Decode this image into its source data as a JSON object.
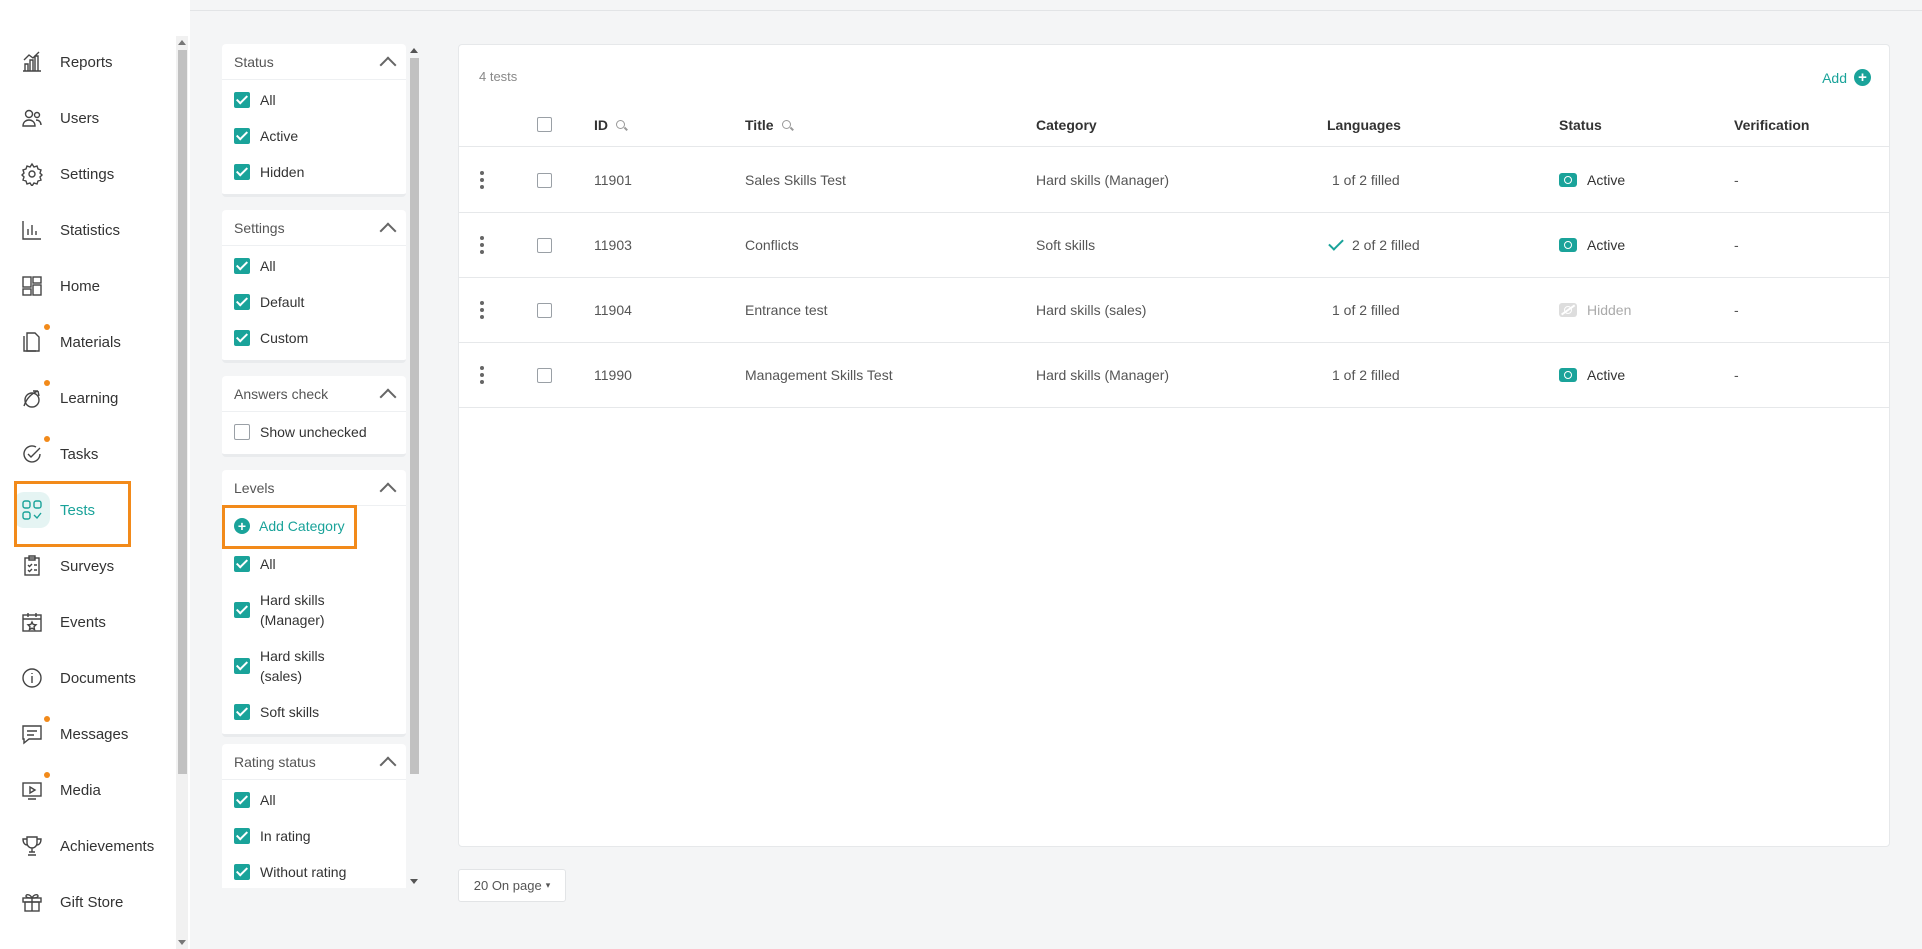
{
  "nav": {
    "items": [
      {
        "label": "Reports",
        "icon": "reports-icon",
        "dot": false
      },
      {
        "label": "Users",
        "icon": "users-icon",
        "dot": false
      },
      {
        "label": "Settings",
        "icon": "gear-icon",
        "dot": false
      },
      {
        "label": "Statistics",
        "icon": "statistics-icon",
        "dot": false
      },
      {
        "label": "Home",
        "icon": "home-icon",
        "dot": false
      },
      {
        "label": "Materials",
        "icon": "materials-icon",
        "dot": true
      },
      {
        "label": "Learning",
        "icon": "learning-icon",
        "dot": true
      },
      {
        "label": "Tasks",
        "icon": "tasks-icon",
        "dot": true
      },
      {
        "label": "Tests",
        "icon": "tests-icon",
        "dot": false,
        "active": true
      },
      {
        "label": "Surveys",
        "icon": "surveys-icon",
        "dot": false
      },
      {
        "label": "Events",
        "icon": "calendar-icon",
        "dot": false
      },
      {
        "label": "Documents",
        "icon": "info-icon",
        "dot": false
      },
      {
        "label": "Messages",
        "icon": "chat-icon",
        "dot": true
      },
      {
        "label": "Media",
        "icon": "media-icon",
        "dot": true
      },
      {
        "label": "Achievements",
        "icon": "trophy-icon",
        "dot": false
      },
      {
        "label": "Gift Store",
        "icon": "gift-icon",
        "dot": false
      }
    ]
  },
  "filters": {
    "status": {
      "title": "Status",
      "options": [
        "All",
        "Active",
        "Hidden"
      ]
    },
    "settings": {
      "title": "Settings",
      "options": [
        "All",
        "Default",
        "Custom"
      ]
    },
    "answers_check": {
      "title": "Answers check",
      "options": [
        "Show unchecked"
      ]
    },
    "levels": {
      "title": "Levels",
      "add_label": "Add Category",
      "options": [
        "All",
        "Hard skills (Manager)",
        "Hard skills (sales)",
        "Soft skills"
      ]
    },
    "rating_status": {
      "title": "Rating status",
      "options": [
        "All",
        "In rating",
        "Without rating"
      ]
    }
  },
  "table": {
    "count_label": "4 tests",
    "add_label": "Add",
    "columns": {
      "id": "ID",
      "title": "Title",
      "category": "Category",
      "languages": "Languages",
      "status": "Status",
      "verification": "Verification"
    },
    "rows": [
      {
        "id": "11901",
        "title": "Sales Skills Test",
        "category": "Hard skills (Manager)",
        "languages": "1 of 2 filled",
        "lang_complete": false,
        "status": "Active",
        "verification": "-"
      },
      {
        "id": "11903",
        "title": "Conflicts",
        "category": "Soft skills",
        "languages": "2 of 2 filled",
        "lang_complete": true,
        "status": "Active",
        "verification": "-"
      },
      {
        "id": "11904",
        "title": "Entrance test",
        "category": "Hard skills (sales)",
        "languages": "1 of 2 filled",
        "lang_complete": false,
        "status": "Hidden",
        "verification": "-"
      },
      {
        "id": "11990",
        "title": "Management Skills Test",
        "category": "Hard skills (Manager)",
        "languages": "1 of 2 filled",
        "lang_complete": false,
        "status": "Active",
        "verification": "-"
      }
    ]
  },
  "pager": {
    "label": "20 On page"
  },
  "colors": {
    "accent": "#1aa39a",
    "highlight": "#f28a1a",
    "dot": "#f28a1a"
  }
}
